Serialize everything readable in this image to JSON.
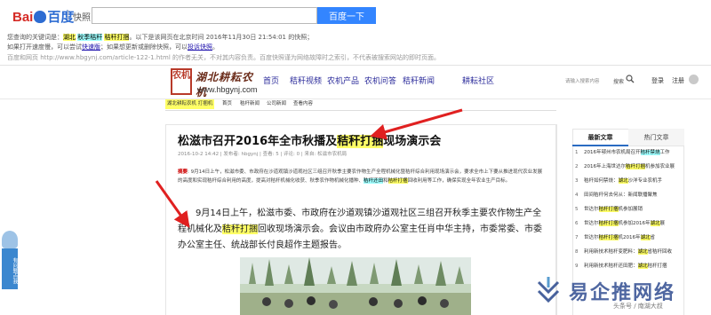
{
  "baidu": {
    "logo_bai": "Bai",
    "logo_du": "du",
    "logo_suffix": "百度",
    "snapshot_label": "快照",
    "search_value": "",
    "search_button": "百度一下",
    "notice_line1_prefix": "您查询的关键词是：",
    "notice_line1_kw1": "湖北",
    "notice_line1_kw2": "秋季秸秆",
    "notice_line1_kw3": "秸秆打捆",
    "notice_line1_suffix": "。以下是该网页在北京时间 2016年11月30日 21:54:01 的快照；",
    "notice_line2_prefix": "如果打开速度慢，可以尝试",
    "notice_line2_link1": "快速版",
    "notice_line2_mid": "；如果想更新或删除快照，可以",
    "notice_line2_link2": "投诉快照",
    "notice_line2_suffix": "。",
    "notice_line3": "百度和网页 http://www.hbgynj.com/article-122-1.html 的作者无关，不对其内容负责。百度快照谨为网络故障时之索引，不代表被搜索网站的即时页面。"
  },
  "site": {
    "logo_seal": "农机",
    "logo_name": "湖北耕耘农机",
    "logo_url": "www.hbgynj.com",
    "nav": [
      "首页",
      "秸秆视频",
      "农机产品",
      "农机问答",
      "秸秆新闻",
      "耕耘社区"
    ],
    "search_placeholder": "请输入搜索内容",
    "search_button": "搜索",
    "login": "登录",
    "register": "注册",
    "subnav": [
      "湖北耕耘农机 打捆机",
      "首页",
      "秸秆新闻",
      "公司新闻",
      "查看内容"
    ]
  },
  "article": {
    "title_prefix": "松滋市召开2016年全市秋播及",
    "title_highlight": "秸秆打捆",
    "title_suffix": "现场演示会",
    "meta": "2016-10-2 14:42  |  发布者: hbgynj  |  查看: 5  |  评论: 0  |  来自: 松滋市农机局",
    "abstract_label": "摘要",
    "abstract_text1": ": 9月14日上午，松滋市委、市政府在沙道观镇沙道观社区三组召开秋季主要农作物生产全程机械化暨秸秆综合利用现场演示会，要求全市上下要从推进现代农业发展的高度和实现秸秆综合利用的高度，提高对秸秆机械化收获、秋季农作物机械化播种、",
    "abstract_kw": "秸秆还田",
    "abstract_text2": "和",
    "abstract_kw2": "秸秆打捆",
    "abstract_text3": "回收利用等工作，确保实现全年农业生产目标。",
    "body_prefix": "9月14日上午，松滋市委、市政府在沙道观镇沙道观社区三组召开秋季主要农作物生产全程机械化及",
    "body_highlight": "秸秆打捆",
    "body_suffix": "回收现场演示会。会议由市政府办公室主任肖中华主持，市委常委、市委办公室主任、统战部长付良超作主题报告。"
  },
  "sidebar": {
    "tab_latest": "最新文章",
    "tab_hot": "热门文章",
    "items": [
      {
        "num": "1",
        "pre": "2016年鄂州市农机局召开",
        "kw": "秸秆禁烧",
        "post": "工作"
      },
      {
        "num": "2",
        "pre": "2016年上海世达尔",
        "kw": "秸秆打捆",
        "post": "机参加农业展"
      },
      {
        "num": "3",
        "pre": "秸秆如何禁烧：",
        "kw": "湖北",
        "post": "沙洋专业农机手"
      },
      {
        "num": "4",
        "pre": "田间秸秆何去何从：新闻联播聚焦",
        "kw": "",
        "post": ""
      },
      {
        "num": "5",
        "pre": "世达尔",
        "kw": "秸秆打捆",
        "post": "机参加展销"
      },
      {
        "num": "6",
        "pre": "世达尔",
        "kw": "秸秆打捆",
        "post": "机参加2016年",
        "kw2": "湖北",
        "post2": "展"
      },
      {
        "num": "7",
        "pre": "世达尔",
        "kw": "秸秆打捆",
        "post": "机2016年",
        "kw2": "湖北",
        "post2": "省"
      },
      {
        "num": "8",
        "pre": "利用新技术秸秆变肥料：",
        "kw": "湖北",
        "post": "省秸秆回收"
      },
      {
        "num": "9",
        "pre": "利用新技术秸秆还田肥：",
        "kw": "湖北",
        "post": "秸秆打捆"
      }
    ]
  },
  "float_badge": {
    "text": "有问题点我"
  },
  "watermark": {
    "text": "易企推网络",
    "sub": "头条号 / 南湖大叔"
  },
  "colors": {
    "baidu_blue": "#3385ff",
    "highlight_yellow": "#ffff66",
    "highlight_cyan": "#a0ffff",
    "arrow_red": "#e02020",
    "nav_link": "#2a2a9a"
  }
}
